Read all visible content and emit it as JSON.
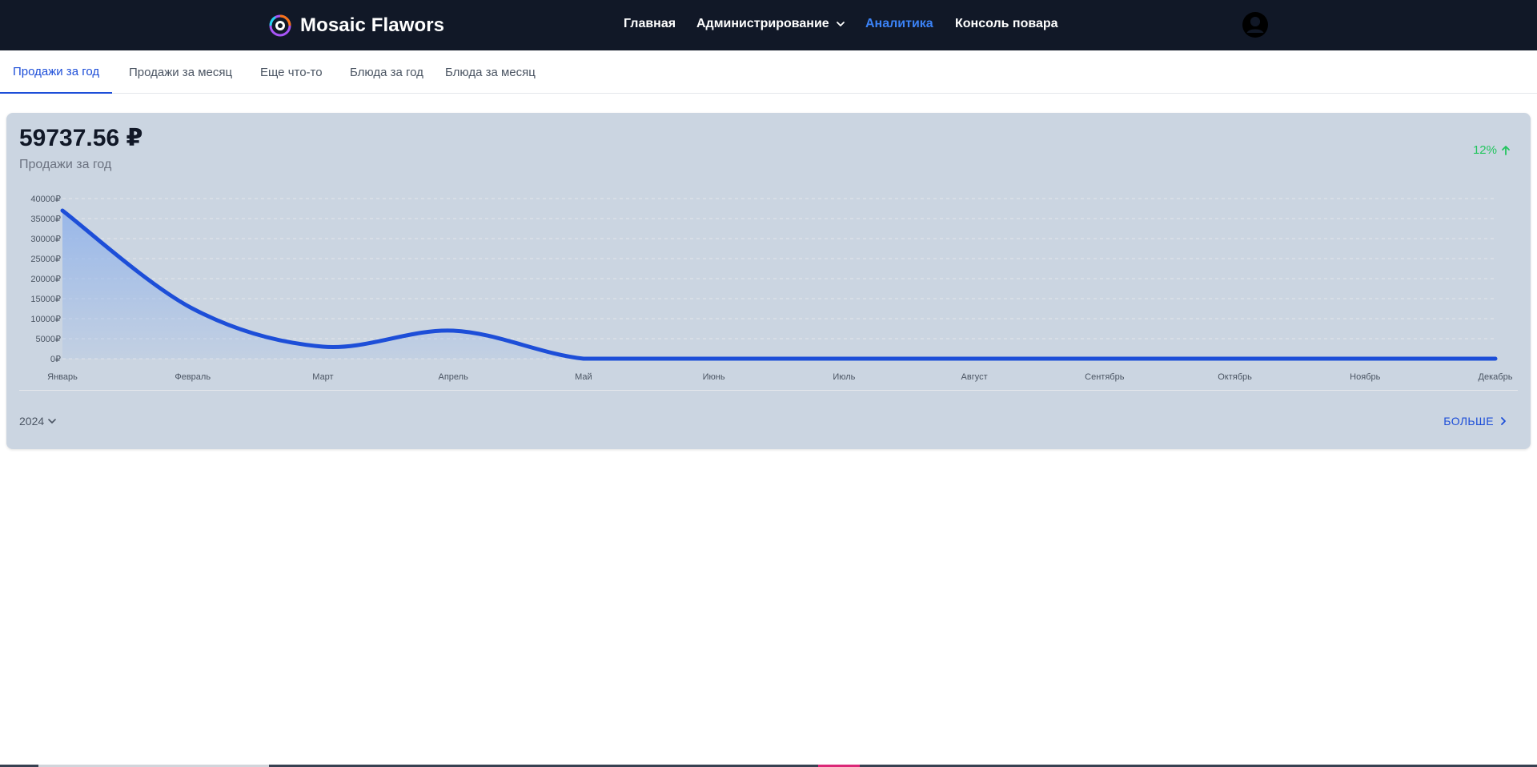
{
  "app": {
    "brand": "Mosaic Flawors"
  },
  "nav": {
    "items": [
      {
        "label": "Главная",
        "active": false
      },
      {
        "label": "Администрирование",
        "active": false,
        "dropdown": true
      },
      {
        "label": "Аналитика",
        "active": true
      },
      {
        "label": "Консоль повара",
        "active": false
      }
    ]
  },
  "tabs": [
    {
      "label": "Продажи за год",
      "active": true
    },
    {
      "label": "Продажи за месяц",
      "active": false
    },
    {
      "label": "Еще что-то",
      "active": false
    },
    {
      "label": "Блюда за год",
      "active": false
    },
    {
      "label": "Блюда за месяц",
      "active": false
    }
  ],
  "card": {
    "total": "59737.56 ₽",
    "subtitle": "Продажи за год",
    "growth": "12%",
    "growth_icon": "arrow-up-icon",
    "year": "2024",
    "more": "БОЛЬШЕ"
  },
  "colors": {
    "accent": "#1d4ed8",
    "line": "#1d4ed8",
    "area": "#93b4ea",
    "growth": "#22c55e",
    "topbar": "#111827",
    "card": "#cbd5e1"
  },
  "chart_data": {
    "type": "area",
    "categories": [
      "Январь",
      "Февраль",
      "Март",
      "Апрель",
      "Май",
      "Июнь",
      "Июль",
      "Август",
      "Сентябрь",
      "Октябрь",
      "Ноябрь",
      "Декабрь"
    ],
    "values": [
      37000,
      12500,
      3000,
      7000,
      0,
      0,
      0,
      0,
      0,
      0,
      0,
      0
    ],
    "yticks": [
      "0₽",
      "5000₽",
      "10000₽",
      "15000₽",
      "20000₽",
      "25000₽",
      "30000₽",
      "35000₽",
      "40000₽"
    ],
    "ylim": [
      0,
      40000
    ],
    "grid": true
  }
}
